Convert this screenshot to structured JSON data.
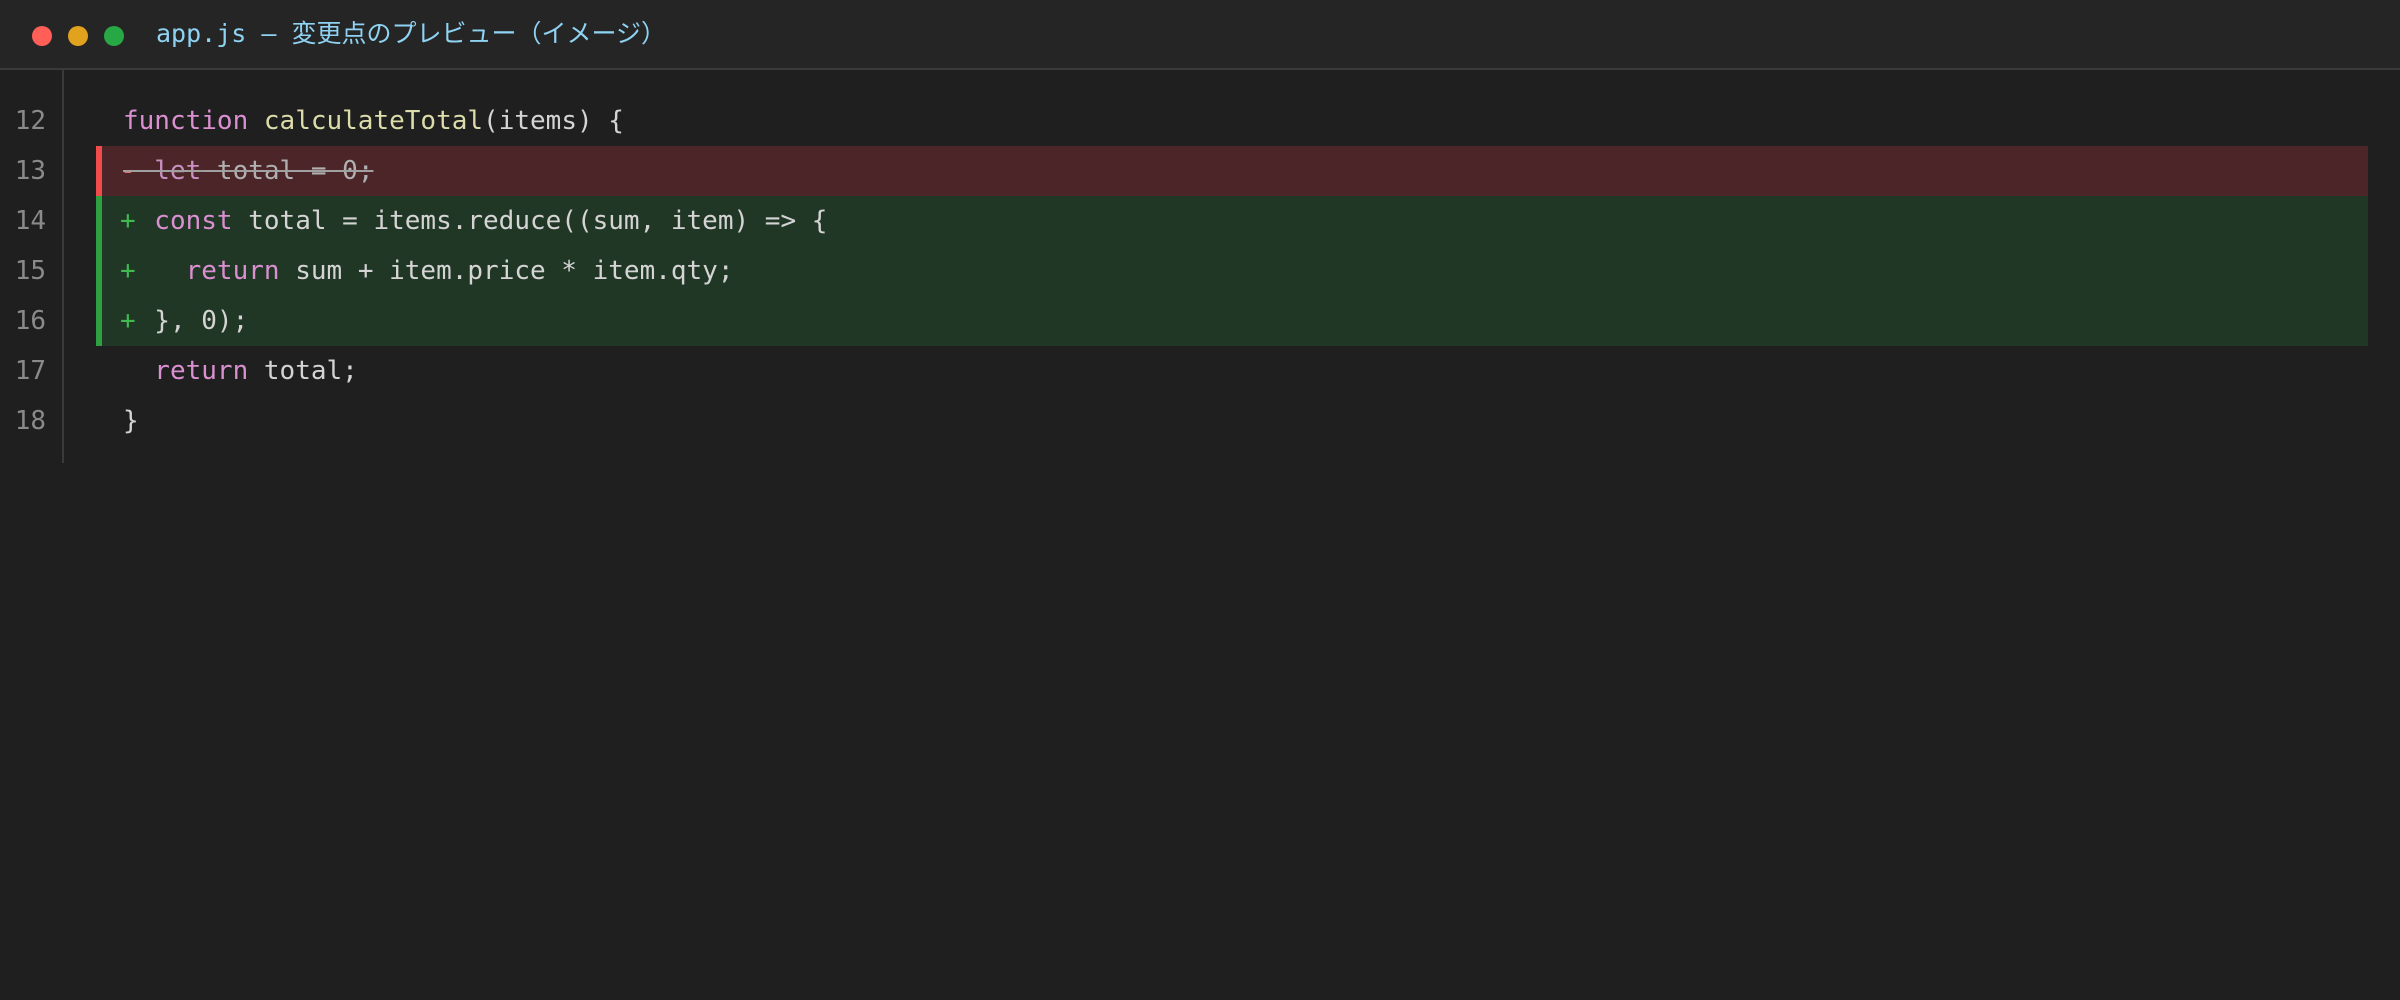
{
  "window": {
    "title": "app.js — 変更点のプレビュー（イメージ）",
    "controls": [
      "close",
      "minimize",
      "maximize"
    ]
  },
  "colors": {
    "keyword": "#d98fd0",
    "function_name": "#dcdcaa",
    "text": "#d4d4d4",
    "removed_bg": "#4b2527",
    "added_bg": "#213726",
    "removed_marker": "#f14c4c",
    "added_marker": "#2ea043"
  },
  "lines": [
    {
      "number": "12",
      "type": "normal",
      "marker": "",
      "tokens": [
        {
          "text": "function",
          "kind": "kw"
        },
        {
          "text": " ",
          "kind": "plain"
        },
        {
          "text": "calculateTotal",
          "kind": "fn"
        },
        {
          "text": "(items) {",
          "kind": "plain"
        }
      ]
    },
    {
      "number": "13",
      "type": "removed",
      "marker": "-",
      "tokens": [
        {
          "text": "  let",
          "kind": "kw"
        },
        {
          "text": " total = 0;",
          "kind": "removed"
        }
      ]
    },
    {
      "number": "14",
      "type": "added",
      "marker": "+",
      "tokens": [
        {
          "text": "  const",
          "kind": "kw"
        },
        {
          "text": " total = items.reduce((sum, item) => {",
          "kind": "plain"
        }
      ]
    },
    {
      "number": "15",
      "type": "added",
      "marker": "+",
      "tokens": [
        {
          "text": "    return",
          "kind": "kw"
        },
        {
          "text": " sum + item.price * item.qty;",
          "kind": "plain"
        }
      ]
    },
    {
      "number": "16",
      "type": "added",
      "marker": "+",
      "tokens": [
        {
          "text": "  }, 0);",
          "kind": "plain"
        }
      ]
    },
    {
      "number": "17",
      "type": "normal",
      "marker": "",
      "tokens": [
        {
          "text": "  return",
          "kind": "kw"
        },
        {
          "text": " total;",
          "kind": "plain"
        }
      ]
    },
    {
      "number": "18",
      "type": "normal",
      "marker": "",
      "tokens": [
        {
          "text": "}",
          "kind": "plain"
        }
      ]
    }
  ]
}
